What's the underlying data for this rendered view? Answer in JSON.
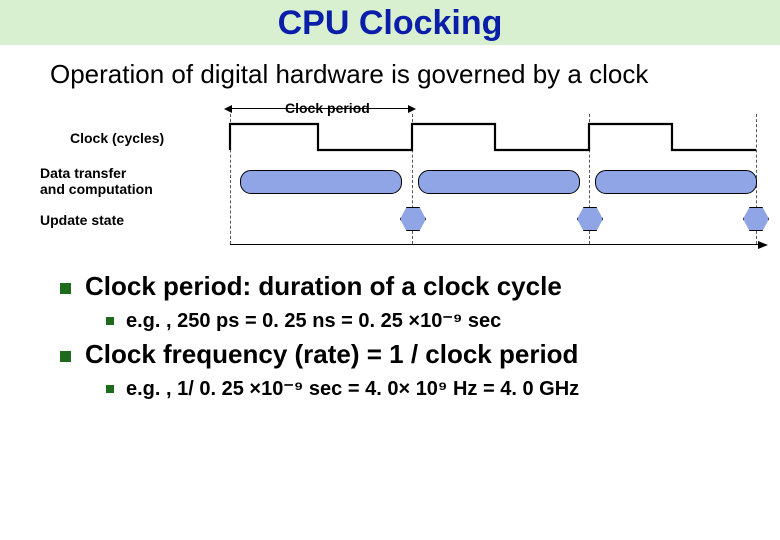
{
  "title": "CPU Clocking",
  "subtitle": "Operation of digital hardware is governed by a clock",
  "diagram": {
    "period_label": "Clock period",
    "cycles_label": "Clock (cycles)",
    "data_label": "Data transfer\nand computation",
    "update_label": "Update state"
  },
  "bullets": {
    "period_def": "Clock period: duration of a clock cycle",
    "period_eg": "e.g. , 250 ps = 0. 25 ns = 0. 25 ×10⁻⁹ sec",
    "freq_def": "Clock frequency (rate) = 1 / clock period",
    "freq_eg": "e.g. , 1/ 0. 25 ×10⁻⁹ sec = 4. 0× 10⁹ Hz = 4. 0 GHz"
  },
  "chart_data": {
    "type": "timing-diagram",
    "title": "CPU clock timing",
    "signals": [
      {
        "name": "Clock (cycles)",
        "kind": "square-wave",
        "cycles_shown": 3,
        "period_arrow": true
      },
      {
        "name": "Data transfer and computation",
        "kind": "bus-valid",
        "segments_per_cycle": 1
      },
      {
        "name": "Update state",
        "kind": "event",
        "events_per_cycle": 1,
        "position": "end-of-cycle"
      }
    ],
    "annotations": [
      "Clock period"
    ]
  }
}
